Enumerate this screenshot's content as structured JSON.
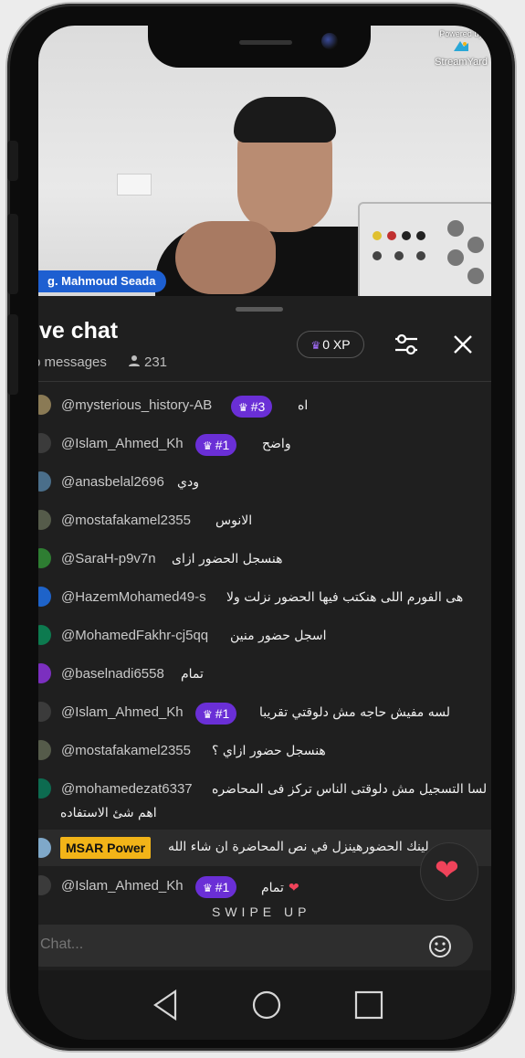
{
  "video": {
    "presenter_name": "g. Mahmoud Seada",
    "watermark_top": "Powered by",
    "watermark_brand": "StreamYard"
  },
  "chat_header": {
    "title": "ive chat",
    "subtitle": "p messages",
    "viewer_count": "231",
    "xp_label": "0 XP",
    "xp_icon": "crown-icon",
    "filter_icon": "sliders-icon",
    "close_icon": "close-icon"
  },
  "messages": [
    {
      "user": "@mysterious_history-AB",
      "badge": "#3",
      "text": "اه",
      "avatar_color": "#8a7a55"
    },
    {
      "user": "@Islam_Ahmed_Kh",
      "badge": "#1",
      "text": "واضح",
      "avatar_color": "#3b3b3b"
    },
    {
      "user": "@anasbelal2696",
      "badge": "",
      "text": "ودي",
      "avatar_color": "#4a6e8a"
    },
    {
      "user": "@mostafakamel2355",
      "badge": "",
      "text": "الانوس",
      "avatar_color": "#555b4a"
    },
    {
      "user": "@SaraH-p9v7n",
      "badge": "",
      "text": "هنسجل الحضور ازاى",
      "avatar_color": "#2e7d32"
    },
    {
      "user": "@HazemMohamed49-s",
      "badge": "",
      "text": "هى الفورم اللى هنكتب فيها الحضور نزلت ولا",
      "avatar_color": "#1e63c9"
    },
    {
      "user": "@MohamedFakhr-cj5qq",
      "badge": "",
      "text": "اسجل حضور منين",
      "avatar_color": "#0d7a4f"
    },
    {
      "user": "@baselnadi6558",
      "badge": "",
      "text": "تمام",
      "avatar_color": "#7b2fbf"
    },
    {
      "user": "@Islam_Ahmed_Kh",
      "badge": "#1",
      "text": "لسه مفيش حاجه مش دلوقتي تقريبا",
      "avatar_color": "#3b3b3b"
    },
    {
      "user": "@mostafakamel2355",
      "badge": "",
      "text": "هنسجل حضور ازاي ؟",
      "avatar_color": "#555b4a"
    },
    {
      "user": "@mohamedezat6337",
      "badge": "",
      "text": "لسا التسجيل مش دلوقتى الناس تركز فى المحاضره",
      "text2": "اهم شئ الاستفاده",
      "avatar_color": "#0d6b50"
    }
  ],
  "pinned": {
    "label": "MSAR Power",
    "text": "لينك الحضورهينزل في نص المحاضرة ان شاء الله",
    "avatar_color": "#7fa8c9"
  },
  "last_message": {
    "user": "@Islam_Ahmed_Kh",
    "badge": "#1",
    "text": "تمام",
    "heart": "❤"
  },
  "swipe_hint": "SWIPE UP",
  "input": {
    "placeholder": "Chat..."
  },
  "heart_button": {
    "icon": "heart-icon"
  },
  "navbar": {
    "back": "back-icon",
    "home": "home-icon",
    "recents": "recents-icon"
  }
}
